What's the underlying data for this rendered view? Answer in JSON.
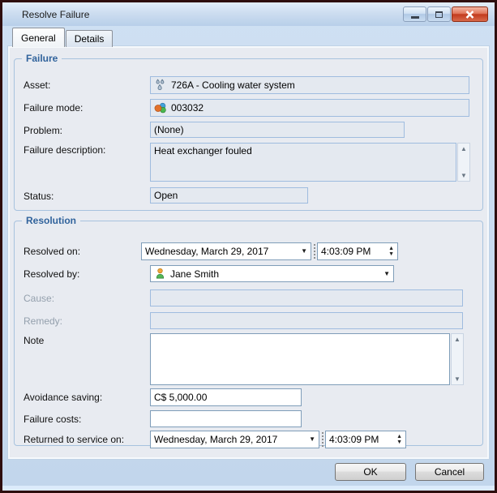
{
  "window": {
    "title": "Resolve Failure",
    "controls": {
      "minimize": "minimize-icon",
      "maximize": "maximize-icon",
      "close": "close-icon"
    }
  },
  "tabs": [
    {
      "label": "General",
      "active": true
    },
    {
      "label": "Details",
      "active": false
    }
  ],
  "failure": {
    "title": "Failure",
    "asset": {
      "label": "Asset:",
      "value": "726A - Cooling water system",
      "icon": "water-drops-icon"
    },
    "mode": {
      "label": "Failure mode:",
      "value": "003032",
      "icon": "colored-balls-icon"
    },
    "problem": {
      "label": "Problem:",
      "value": "(None)"
    },
    "description": {
      "label": "Failure description:",
      "value": "Heat exchanger fouled"
    },
    "status": {
      "label": "Status:",
      "value": "Open"
    }
  },
  "resolution": {
    "title": "Resolution",
    "resolved_on": {
      "label": "Resolved on:",
      "date": "Wednesday, March 29, 2017",
      "time": "4:03:09 PM"
    },
    "resolved_by": {
      "label": "Resolved by:",
      "value": "Jane Smith",
      "icon": "user-icon"
    },
    "cause": {
      "label": "Cause:",
      "value": ""
    },
    "remedy": {
      "label": "Remedy:",
      "value": ""
    },
    "note": {
      "label": "Note",
      "value": ""
    },
    "avoidance_saving": {
      "label": "Avoidance saving:",
      "value": "C$ 5,000.00"
    },
    "failure_costs": {
      "label": "Failure costs:",
      "value": ""
    },
    "returned_on": {
      "label": "Returned to service on:",
      "date": "Wednesday, March 29, 2017",
      "time": "4:03:09 PM"
    }
  },
  "footer": {
    "ok_label": "OK",
    "cancel_label": "Cancel"
  },
  "colors": {
    "window_border": "#2e0e0e",
    "titlebar_top": "#e3eefa",
    "titlebar_bottom": "#b8cfe9",
    "window_bg": "#cfe0f3",
    "panel_bg": "#e8ebf1",
    "group_border": "#a7c2de",
    "group_title_blue": "#31639c",
    "readonly_field_bg": "#e4e9f0",
    "readonly_field_border": "#9fbcdf",
    "editable_field_border": "#7f9db9",
    "close_button_red": "#c23a1d"
  }
}
